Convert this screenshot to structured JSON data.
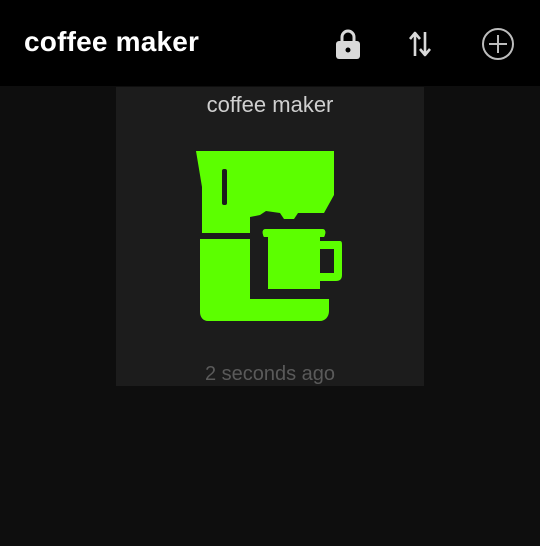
{
  "header": {
    "title": "coffee maker",
    "actions": [
      {
        "icon": "lock-icon"
      },
      {
        "icon": "sort-icon"
      },
      {
        "icon": "add-circle-icon"
      }
    ]
  },
  "card": {
    "name": "coffee maker",
    "icon": "coffee-maker-icon",
    "icon_color": "#5cff00",
    "last_updated": "2 seconds ago"
  },
  "colors": {
    "background": "#0e0e0e",
    "topbar": "#000000",
    "card": "#1c1c1c",
    "accent": "#5cff00"
  }
}
